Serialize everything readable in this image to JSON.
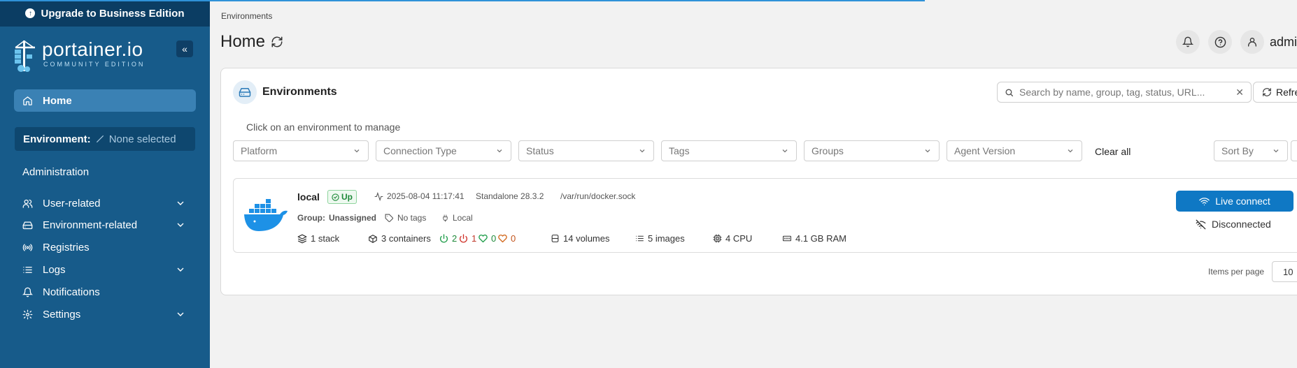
{
  "upgrade": {
    "label": "Upgrade to Business Edition"
  },
  "logo": {
    "name": "portainer.io",
    "edition": "COMMUNITY EDITION"
  },
  "sidebar": {
    "collapse_glyph": "«",
    "home_label": "Home",
    "environment_label": "Environment:",
    "environment_value": "None selected",
    "admin_title": "Administration",
    "items": [
      {
        "label": "User-related",
        "icon": "users-icon",
        "expandable": true
      },
      {
        "label": "Environment-related",
        "icon": "hard-drive-icon",
        "expandable": true
      },
      {
        "label": "Registries",
        "icon": "radio-icon",
        "expandable": false
      },
      {
        "label": "Logs",
        "icon": "list-icon",
        "expandable": true
      },
      {
        "label": "Notifications",
        "icon": "bell-icon",
        "expandable": false
      },
      {
        "label": "Settings",
        "icon": "gear-icon",
        "expandable": true
      }
    ]
  },
  "header": {
    "breadcrumb": "Environments",
    "title": "Home",
    "user": "admin"
  },
  "panel": {
    "title": "Environments",
    "search_placeholder": "Search by name, group, tag, status, URL...",
    "refresh_label": "Refresh",
    "hint": "Click on an environment to manage",
    "filters": [
      "Platform",
      "Connection Type",
      "Status",
      "Tags",
      "Groups",
      "Agent Version"
    ],
    "clear_all": "Clear all",
    "sort_by": "Sort By",
    "items_per_page_label": "Items per page",
    "items_per_page_value": "10"
  },
  "environment": {
    "name": "local",
    "status": "Up",
    "timestamp": "2025-08-04 11:17:41",
    "type": "Standalone 28.3.2",
    "socket": "/var/run/docker.sock",
    "group_label": "Group:",
    "group_value": "Unassigned",
    "tags": "No tags",
    "locality": "Local",
    "stacks": "1 stack",
    "containers": "3 containers",
    "running": "2",
    "stopped": "1",
    "healthy": "0",
    "unhealthy": "0",
    "volumes": "14 volumes",
    "images": "5 images",
    "cpu": "4 CPU",
    "ram": "4.1 GB RAM",
    "live_connect": "Live connect",
    "connection": "Disconnected"
  },
  "colors": {
    "sidebar": "#175b8a",
    "accent": "#0f78c4",
    "up": "#1f8a3a"
  }
}
